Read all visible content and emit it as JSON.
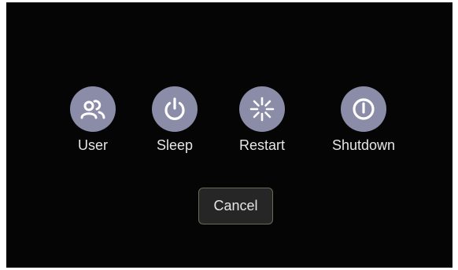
{
  "dialog": {
    "options": [
      {
        "label": "User",
        "icon": "users-icon"
      },
      {
        "label": "Sleep",
        "icon": "power-icon"
      },
      {
        "label": "Restart",
        "icon": "restart-icon"
      },
      {
        "label": "Shutdown",
        "icon": "shutdown-icon"
      }
    ],
    "cancel_label": "Cancel"
  },
  "colors": {
    "background": "#050505",
    "icon_circle": "#8a8ca8",
    "icon_glyph": "#ffffff",
    "text": "#e6e6e6",
    "cancel_bg": "#262626",
    "cancel_border": "#6b6a55"
  }
}
